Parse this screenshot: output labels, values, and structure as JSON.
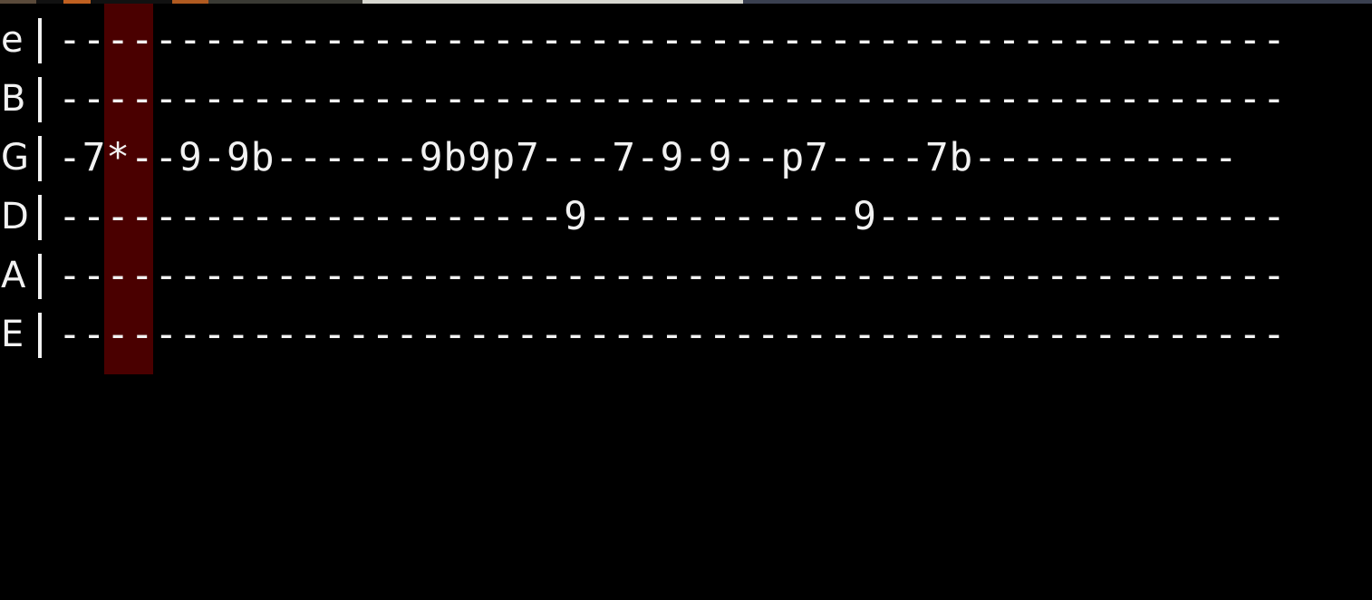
{
  "tab": {
    "strings": [
      {
        "name": "e",
        "notation": "---------------------------------------------------"
      },
      {
        "name": "B",
        "notation": "---------------------------------------------------"
      },
      {
        "name": "G",
        "notation": "-7*--9-9b------9b9p7---7-9-9--p7----7b-----------"
      },
      {
        "name": "D",
        "notation": "---------------------9-----------9-----------------"
      },
      {
        "name": "A",
        "notation": "---------------------------------------------------"
      },
      {
        "name": "E",
        "notation": "---------------------------------------------------"
      }
    ]
  },
  "colors": {
    "background": "#000000",
    "text": "#f2f2f2",
    "highlight": "#4a0000"
  }
}
